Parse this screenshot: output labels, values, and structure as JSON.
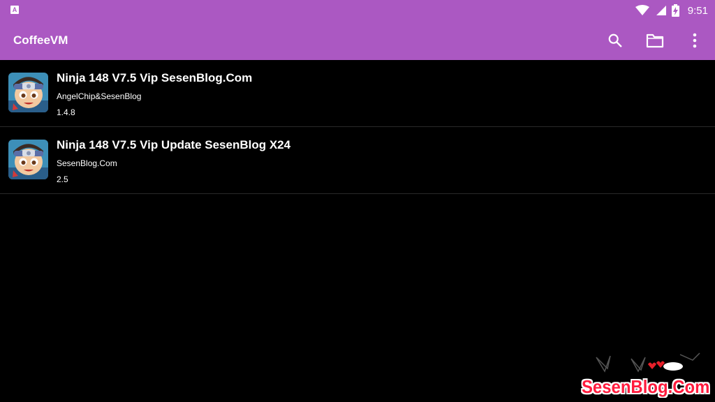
{
  "status_bar": {
    "time": "9:51",
    "notification_icon": "accessibility-a-icon",
    "icons": [
      "wifi-icon",
      "signal-icon",
      "battery-charging-icon"
    ]
  },
  "app_bar": {
    "title": "CoffeeVM",
    "actions": [
      "search-icon",
      "folder-icon",
      "more-vert-icon"
    ],
    "color": "#ab58c2"
  },
  "items": [
    {
      "title": "Ninja 148 V7.5 Vip SesenBlog.Com",
      "author": "AngelChip&SesenBlog",
      "version": "1.4.8",
      "icon": "ninja-game-icon"
    },
    {
      "title": "Ninja 148 V7.5 Vip Update SesenBlog X24",
      "author": "SesenBlog.Com",
      "version": "2.5",
      "icon": "ninja-game-icon"
    }
  ],
  "watermark": {
    "text": "SesenBlog.Com",
    "color": "#ff1b3d"
  }
}
